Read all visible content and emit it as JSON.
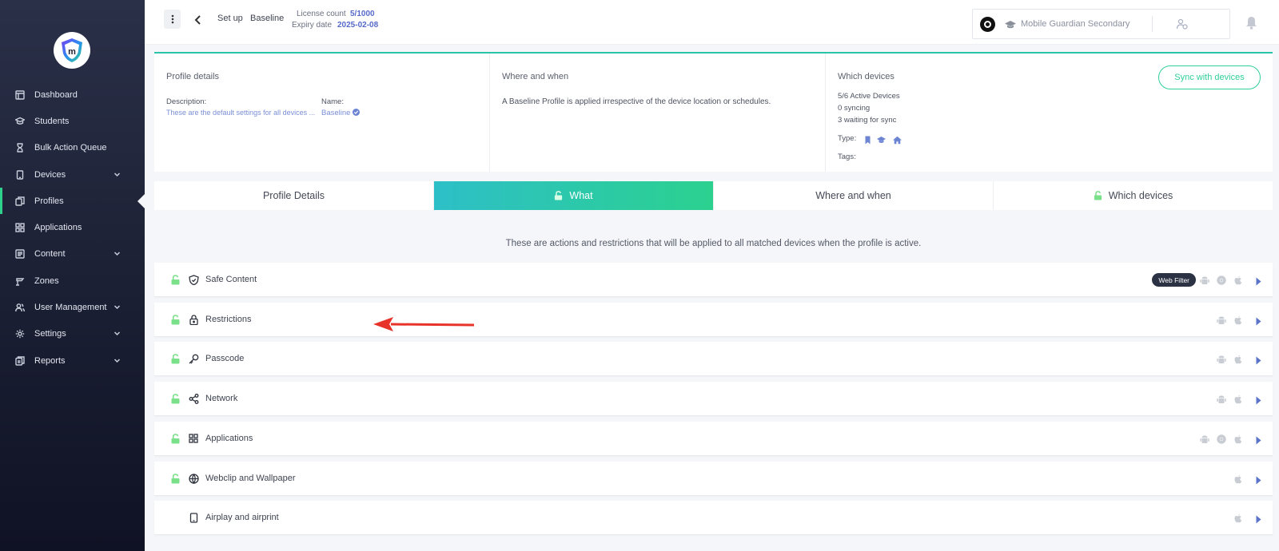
{
  "sidebar": {
    "items": [
      {
        "label": "Dashboard",
        "icon": "dashboard-icon"
      },
      {
        "label": "Students",
        "icon": "students-icon"
      },
      {
        "label": "Bulk Action Queue",
        "icon": "hourglass-icon"
      },
      {
        "label": "Devices",
        "icon": "device-icon",
        "expandable": true
      },
      {
        "label": "Profiles",
        "icon": "profiles-icon",
        "active": true
      },
      {
        "label": "Applications",
        "icon": "apps-grid-icon"
      },
      {
        "label": "Content",
        "icon": "content-icon",
        "expandable": true
      },
      {
        "label": "Zones",
        "icon": "zones-icon"
      },
      {
        "label": "User Management",
        "icon": "users-icon",
        "expandable": true
      },
      {
        "label": "Settings",
        "icon": "gear-icon",
        "expandable": true
      },
      {
        "label": "Reports",
        "icon": "reports-icon",
        "expandable": true
      }
    ]
  },
  "header": {
    "crumb_setup": "Set up",
    "crumb_baseline": "Baseline",
    "license_label": "License count",
    "license_value": "5/1000",
    "expiry_label": "Expiry date",
    "expiry_value": "2025-02-08",
    "org_name": "Mobile Guardian Secondary"
  },
  "profile_details": {
    "title": "Profile details",
    "description_label": "Description:",
    "description_value": "These are the default settings for all devices ...",
    "name_label": "Name:",
    "name_value": "Baseline"
  },
  "where_when": {
    "title": "Where and when",
    "text": "A Baseline Profile is applied irrespective of the device location or schedules."
  },
  "which_devices": {
    "title": "Which devices",
    "active": "5/6 Active Devices",
    "syncing": "0 syncing",
    "waiting": "3 waiting for sync",
    "type_label": "Type:",
    "tags_label": "Tags:",
    "sync_button": "Sync with devices"
  },
  "tabs": [
    {
      "label": "Profile Details",
      "lock": false,
      "active": false
    },
    {
      "label": "What",
      "lock": true,
      "active": true
    },
    {
      "label": "Where and when",
      "lock": false,
      "active": false
    },
    {
      "label": "Which devices",
      "lock": true,
      "active": false
    }
  ],
  "description": "These are actions and restrictions that will be applied to all matched devices when the profile is active.",
  "rows": [
    {
      "label": "Safe Content",
      "icon": "shield-icon",
      "badge": "Web Filter",
      "platforms": [
        "android",
        "chrome",
        "apple"
      ]
    },
    {
      "label": "Restrictions",
      "icon": "lock-icon",
      "platforms": [
        "android",
        "apple"
      ]
    },
    {
      "label": "Passcode",
      "icon": "key-icon",
      "platforms": [
        "android",
        "apple"
      ]
    },
    {
      "label": "Network",
      "icon": "share-icon",
      "platforms": [
        "android",
        "apple"
      ]
    },
    {
      "label": "Applications",
      "icon": "apps-grid-icon",
      "platforms": [
        "android",
        "chrome",
        "apple"
      ]
    },
    {
      "label": "Webclip and Wallpaper",
      "icon": "globe-icon",
      "platforms": [
        "apple"
      ]
    },
    {
      "label": "Airplay and airprint",
      "icon": "tablet-icon",
      "platforms": [
        "apple"
      ]
    }
  ],
  "colors": {
    "accent_green": "#2fd08c",
    "accent_teal": "#2dbfc7",
    "link_blue": "#5569c8",
    "lock_green": "#7be08a"
  }
}
